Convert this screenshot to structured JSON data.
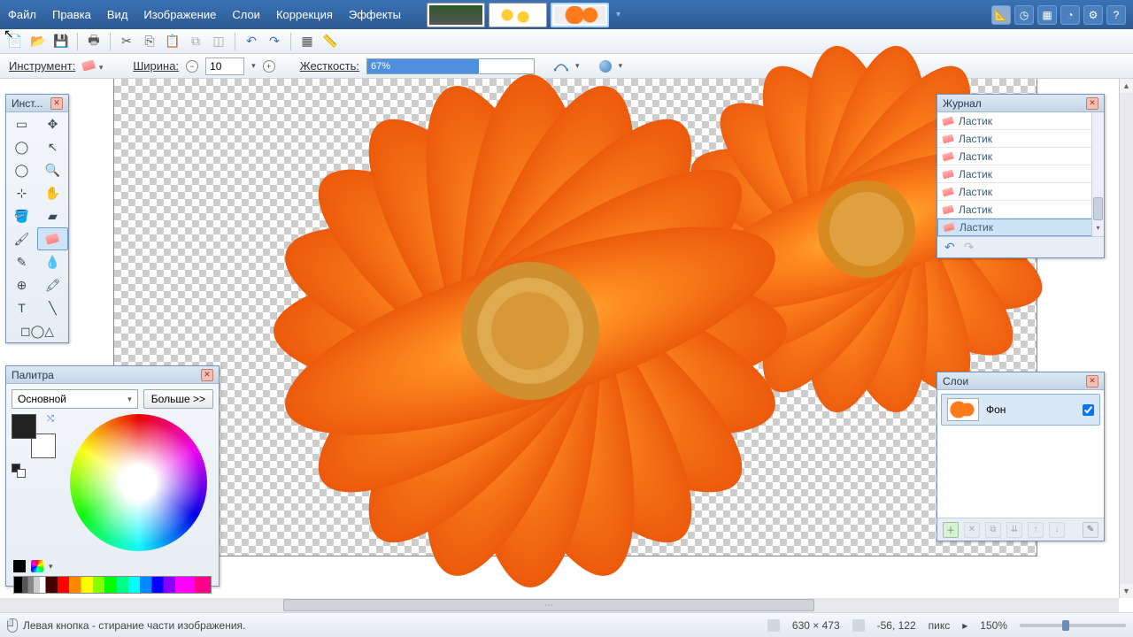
{
  "menu": {
    "file": "Файл",
    "edit": "Правка",
    "view": "Вид",
    "image": "Изображение",
    "layers": "Слои",
    "correction": "Коррекция",
    "effects": "Эффекты"
  },
  "options": {
    "tool_label": "Инструмент:",
    "width_label": "Ширина:",
    "width_value": "10",
    "hardness_label": "Жесткость:",
    "hardness_value": "67%",
    "hardness_pct": 67
  },
  "panels": {
    "tools_title": "Инст...",
    "palette_title": "Палитра",
    "palette_main": "Основной",
    "palette_more": "Больше >>",
    "history_title": "Журнал",
    "history_item": "Ластик",
    "layers_title": "Слои",
    "layer_bg": "Фон"
  },
  "status": {
    "hint": "Левая кнопка - стирание части изображения.",
    "dims": "630 × 473",
    "coords": "-56, 122",
    "unit": "пикс",
    "zoom": "150%"
  }
}
